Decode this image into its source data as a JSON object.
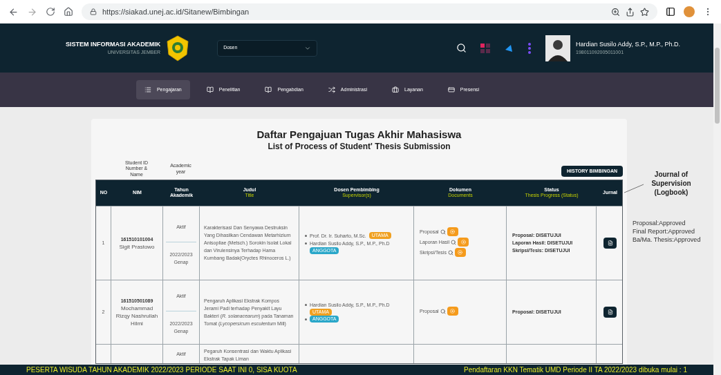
{
  "browser": {
    "url": "https://siakad.unej.ac.id/Sitanew/Bimbingan"
  },
  "header": {
    "title": "SISTEM INFORMASI AKADEMIK",
    "subtitle": "UNIVERSITAS JEMBER",
    "role_select": "Dosen",
    "user_name": "Hardian Susilo Addy, S.P., M.P., Ph.D.",
    "user_id": "198011092005011001"
  },
  "nav": [
    {
      "label": "Pengajaran",
      "selected": true
    },
    {
      "label": "Penelitian",
      "selected": false
    },
    {
      "label": "Pengabdian",
      "selected": false
    },
    {
      "label": "Administrasi",
      "selected": false
    },
    {
      "label": "Layanan",
      "selected": false
    },
    {
      "label": "Presensi",
      "selected": false
    }
  ],
  "page": {
    "title": "Daftar Pengajuan Tugas Akhir Mahasiswa",
    "subtitle": "List of Process of Student' Thesis Submission",
    "history_button": "HISTORY BIMBINGAN"
  },
  "annotations": {
    "student_id": "Student ID Number & Name",
    "academic_year": "Academic year",
    "journal": "Journal of Supervision (Logbook)",
    "approvals": [
      "Proposal:Approved",
      "Final Report:Approved",
      "Ba/Ma. Thesis:Approved"
    ]
  },
  "table": {
    "columns": [
      {
        "label": "NO"
      },
      {
        "label": "NIM"
      },
      {
        "label": "Tahun Akademik"
      },
      {
        "label": "Judul",
        "sublabel": "Title"
      },
      {
        "label": "Dosen Pembimbing",
        "sublabel": "Supervisor(s)"
      },
      {
        "label": "Dokumen",
        "sublabel": "Documents"
      },
      {
        "label": "Status",
        "sublabel": "Thesis Progress (Status)"
      },
      {
        "label": "Jurnal"
      }
    ],
    "rows": [
      {
        "no": "1",
        "nim": "161510101004",
        "name": "Sigit Prastowo",
        "status": "Aktif",
        "year": "2022/2023",
        "semester": "Genap",
        "title": "Karakterisasi Dan Senyawa Destruksin Yang Dihasilkan Cendawan Metarhizium Anisopliae (Metsch.) Sorokin Isolat Lokal dan Virulensinya Terhadap Hama Kumbang Badak(Oryctes Rhinoceros L.)",
        "supervisors": [
          {
            "name": "Prof. Dr. Ir. Suharto, M.Sc.",
            "badge": "UTAMA",
            "kind": "main"
          },
          {
            "name": "Hardian Susilo Addy, S.P., M.P., Ph.D",
            "badge": "ANGGOTA",
            "kind": "member"
          }
        ],
        "documents": [
          "Proposal",
          "Laporan Hasil",
          "Skripsi/Tesis"
        ],
        "statuses": [
          "Proposal: DISETUJUI",
          "Laporan Hasil: DISETUJUI",
          "Skripsi/Tesis: DISETUJUI"
        ]
      },
      {
        "no": "2",
        "nim": "161510501089",
        "name": "Mochammad Rizqy Nashrullah Hilmi",
        "status": "Aktif",
        "year": "2022/2023",
        "semester": "Genap",
        "title": "Pengaruh Aplikasi Ekstrak Kompos Jerami Padi terhadap Penyakit Layu Bakteri (*R. solanacearum*) pada Tanaman Tomat (*Lycopersicum esculentum* Mill)",
        "supervisors": [
          {
            "name": "Hardian Susilo Addy, S.P., M.P., Ph.D",
            "badge": "UTAMA",
            "kind": "main"
          },
          {
            "badge": "ANGGOTA",
            "kind": "member"
          }
        ],
        "documents": [
          "Proposal"
        ],
        "statuses": [
          "Proposal: DISETUJUI"
        ]
      },
      {
        "status": "Aktif",
        "title": "Pegaruh Konsentrasi dan Waktu Aplikasi Ekstrak Tapak Liman"
      }
    ]
  },
  "ticker": [
    "PESERTA WISUDA TAHUN AKADEMIK 2022/2023 PERIODE SAAT INI 0, SISA KUOTA",
    "Pendaftaran KKN Tematik UMD Periode II TA 2022/2023 dibuka mulai : 1"
  ]
}
